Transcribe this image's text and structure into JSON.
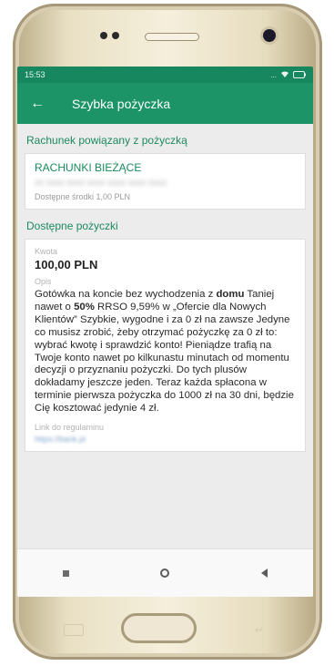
{
  "status_bar": {
    "time": "15:53",
    "signal": "...",
    "wifi": "wifi",
    "battery": "battery"
  },
  "header": {
    "back_icon": "←",
    "title": "Szybka pożyczka"
  },
  "account_section": {
    "title": "Rachunek powiązany z pożyczką",
    "account_name": "RACHUNKI BIEŻĄCE",
    "account_number": "00 0000 0000 0000 0000 0000 0000",
    "available_funds": "Dostępne środki 1,00 PLN"
  },
  "loans_section": {
    "title": "Dostępne pożyczki",
    "amount_label": "Kwota",
    "amount_value": "100,00 PLN",
    "description_label": "Opis",
    "description_part1": "Gotówka na koncie bez wychodzenia z ",
    "description_bold1": "domu",
    "description_part2": " Taniej nawet o ",
    "description_bold2": "50%",
    "description_part3": " RRSO 9,59% w „Ofercie dla Nowych Klientów” Szybkie, wygodne i za 0 zł na zawsze Jedyne co musisz zrobić, żeby otrzymać pożyczkę za 0 zł to: wybrać kwotę i sprawdzić konto! Pieniądze trafią na Twoje konto nawet po kilkunastu minutach od momentu decyzji o przyznaniu pożyczki. Do tych plusów dokładamy jeszcze jeden. Teraz każda spłacona w terminie pierwsza pożyczka do 1000 zł na 30 dni, będzie Cię kosztować jedynie 4 zł.",
    "regulation_label": "Link do regulaminu",
    "regulation_link": "https://bank.pl"
  },
  "nav_bar": {
    "recent_icon": "square-icon",
    "home_icon": "circle-icon",
    "back_icon": "triangle-back-icon"
  }
}
